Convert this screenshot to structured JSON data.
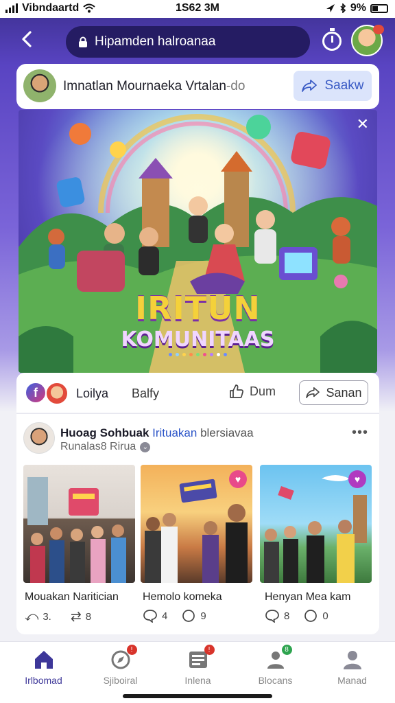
{
  "status_bar": {
    "carrier": "Vibndaartd",
    "time": "1S62 3M",
    "battery": "9%"
  },
  "topbar": {
    "url_text": "Hipamden halroanaa",
    "icons": [
      "back-arrow-icon",
      "lock-icon",
      "timer-icon",
      "avatar"
    ]
  },
  "creator": {
    "name": "Imnatlan Mournaeka Vrtalan",
    "name_suffix": "-do",
    "share_label": "Saakw"
  },
  "banner": {
    "title_line1": "IRITUN",
    "title_line2": "KOMUNITAAS",
    "close_icon": "close-icon",
    "dot_colors": [
      "#6a8cff",
      "#8fd0ff",
      "#ffd34d",
      "#ff8a4d",
      "#7be07b",
      "#f04f8f",
      "#b37bff",
      "#ffffff",
      "#6a8cff"
    ]
  },
  "reaction_bar": {
    "label1": "Loilya",
    "label2": "Balfy",
    "like_label": "Dum",
    "share_label": "Sanan"
  },
  "post": {
    "title_bold": "Huoag Sohbuak",
    "title_link": "Irituakan",
    "title_rest": "blersiavaa",
    "subtitle": "Runalas8 Rirua",
    "items": [
      {
        "label": "Mouakan Naritician",
        "stat1": "3.",
        "stat2": "8",
        "stat1_icon": "reply-icon",
        "stat2_icon": "repost-icon"
      },
      {
        "label": "Hemolo komeka",
        "stat1": "4",
        "stat2": "9",
        "stat1_icon": "comment-icon",
        "stat2_icon": "chat-icon"
      },
      {
        "label": "Henyan Mea kam",
        "stat1": "8",
        "stat2": "0",
        "stat1_icon": "comment-icon",
        "stat2_icon": "chat-icon"
      }
    ]
  },
  "bottom_nav": [
    {
      "label": "Irlbomad",
      "icon": "home-icon",
      "active": true,
      "badge": false
    },
    {
      "label": "Sjiboiral",
      "icon": "explore-icon",
      "active": false,
      "badge": true
    },
    {
      "label": "Inlena",
      "icon": "news-icon",
      "active": false,
      "badge": true
    },
    {
      "label": "Blocans",
      "icon": "groups-icon",
      "active": false,
      "badge": true
    },
    {
      "label": "Manad",
      "icon": "profile-icon",
      "active": false,
      "badge": false
    }
  ],
  "colors": {
    "accent": "#3d3799",
    "header_pill": "#251c63",
    "share_bg": "#dbe4fb",
    "link_blue": "#2c55c8"
  }
}
